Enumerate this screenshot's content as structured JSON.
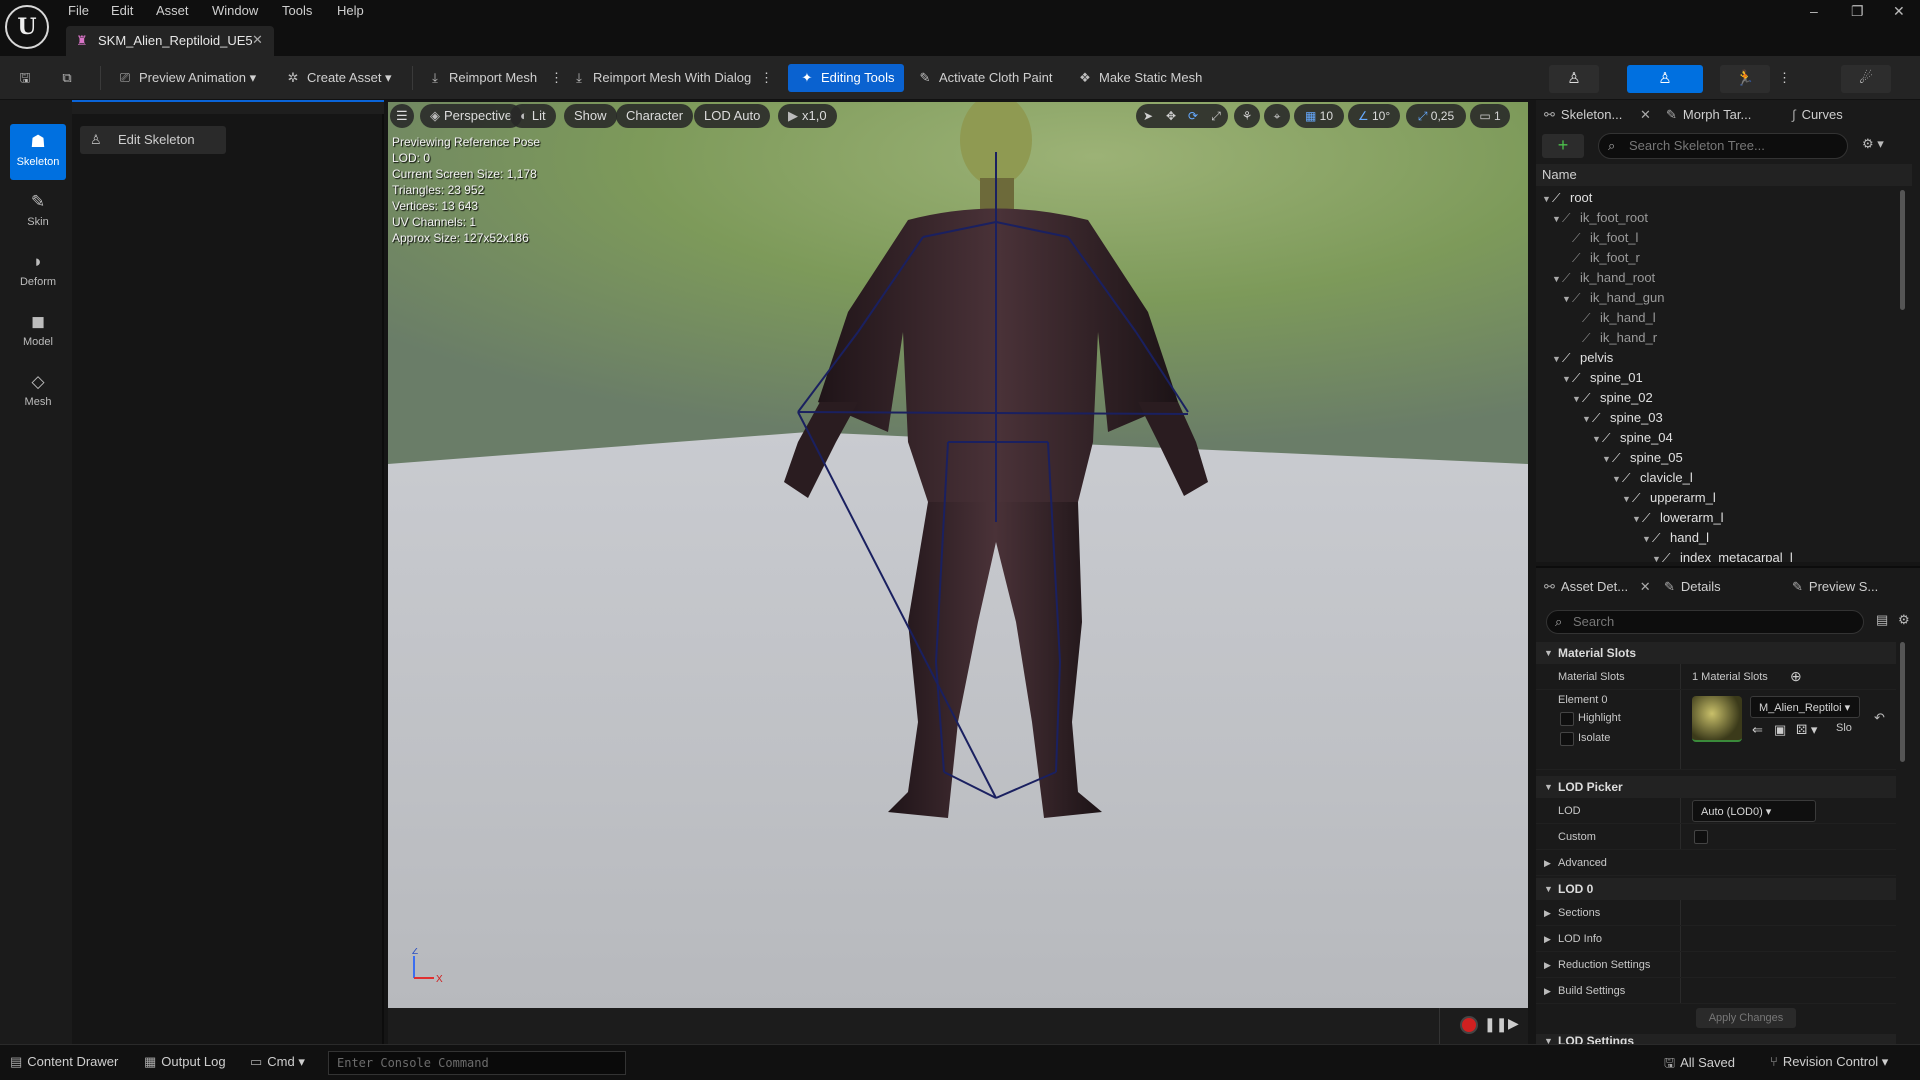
{
  "app": {
    "logo_text": "U",
    "menu": [
      "File",
      "Edit",
      "Asset",
      "Window",
      "Tools",
      "Help"
    ],
    "doc_tab": "SKM_Alien_Reptiloid_UE5",
    "window_controls": [
      "–",
      "❐",
      "✕"
    ]
  },
  "toolbar": {
    "preview_animation": "Preview Animation",
    "create_asset": "Create Asset",
    "reimport_mesh": "Reimport Mesh",
    "reimport_dialog": "Reimport Mesh With Dialog",
    "editing_tools": "Editing Tools",
    "cloth_paint": "Activate Cloth Paint",
    "make_static": "Make Static Mesh",
    "accent": "#0070e0"
  },
  "left_strip": [
    {
      "label": "Skeleton",
      "icon": "skeleton-icon",
      "glyph": "☗"
    },
    {
      "label": "Skin",
      "icon": "skin-icon",
      "glyph": "✎"
    },
    {
      "label": "Deform",
      "icon": "deform-icon",
      "glyph": "◗"
    },
    {
      "label": "Model",
      "icon": "model-icon",
      "glyph": "◼"
    },
    {
      "label": "Mesh",
      "icon": "mesh-icon",
      "glyph": "◇"
    }
  ],
  "left_panel": {
    "edit_skeleton": "Edit Skeleton"
  },
  "viewport": {
    "perspective": "Perspective",
    "lit": "Lit",
    "show": "Show",
    "character": "Character",
    "lod": "LOD Auto",
    "speed": "x1,0",
    "grid_snap": "10",
    "rot_snap": "10°",
    "scale_snap": "0,25",
    "camera_speed": "1",
    "stats": [
      "Previewing Reference Pose",
      "LOD: 0",
      "Current Screen Size: 1,178",
      "Triangles: 23 952",
      "Vertices: 13 643",
      "UV Channels: 1",
      "Approx Size: 127x52x186"
    ],
    "axis_z": "Z",
    "axis_x": "X"
  },
  "skeleton_panel": {
    "tabs": [
      "Skeleton...",
      "Morph Tar...",
      "Curves"
    ],
    "search_placeholder": "Search Skeleton Tree...",
    "column": "Name",
    "bones": [
      {
        "name": "root",
        "depth": 0,
        "expanded": true,
        "virtual": false
      },
      {
        "name": "ik_foot_root",
        "depth": 1,
        "expanded": true,
        "virtual": true
      },
      {
        "name": "ik_foot_l",
        "depth": 2,
        "expanded": false,
        "virtual": true
      },
      {
        "name": "ik_foot_r",
        "depth": 2,
        "expanded": false,
        "virtual": true
      },
      {
        "name": "ik_hand_root",
        "depth": 1,
        "expanded": true,
        "virtual": true
      },
      {
        "name": "ik_hand_gun",
        "depth": 2,
        "expanded": true,
        "virtual": true
      },
      {
        "name": "ik_hand_l",
        "depth": 3,
        "expanded": false,
        "virtual": true
      },
      {
        "name": "ik_hand_r",
        "depth": 3,
        "expanded": false,
        "virtual": true
      },
      {
        "name": "pelvis",
        "depth": 1,
        "expanded": true,
        "virtual": false
      },
      {
        "name": "spine_01",
        "depth": 2,
        "expanded": true,
        "virtual": false
      },
      {
        "name": "spine_02",
        "depth": 3,
        "expanded": true,
        "virtual": false
      },
      {
        "name": "spine_03",
        "depth": 4,
        "expanded": true,
        "virtual": false
      },
      {
        "name": "spine_04",
        "depth": 5,
        "expanded": true,
        "virtual": false
      },
      {
        "name": "spine_05",
        "depth": 6,
        "expanded": true,
        "virtual": false
      },
      {
        "name": "clavicle_l",
        "depth": 7,
        "expanded": true,
        "virtual": false
      },
      {
        "name": "upperarm_l",
        "depth": 8,
        "expanded": true,
        "virtual": false
      },
      {
        "name": "lowerarm_l",
        "depth": 9,
        "expanded": true,
        "virtual": false
      },
      {
        "name": "hand_l",
        "depth": 10,
        "expanded": true,
        "virtual": false
      },
      {
        "name": "index_metacarpal_l",
        "depth": 11,
        "expanded": true,
        "virtual": false
      }
    ]
  },
  "details_panel": {
    "tabs": [
      "Asset Det...",
      "Details",
      "Preview S..."
    ],
    "search_placeholder": "Search",
    "material_slots_section": "Material Slots",
    "material_slots_label": "Material Slots",
    "material_slots_value": "1 Material Slots",
    "element0": "Element 0",
    "highlight": "Highlight",
    "isolate": "Isolate",
    "material_name": "M_Alien_Reptiloi",
    "slot_label": "Slo",
    "lod_picker_section": "LOD Picker",
    "lod_label": "LOD",
    "lod_value": "Auto (LOD0)",
    "custom_label": "Custom",
    "advanced": "Advanced",
    "lod0_section": "LOD 0",
    "sections": "Sections",
    "lod_info": "LOD Info",
    "reduction": "Reduction Settings",
    "build": "Build Settings",
    "apply_changes": "Apply Changes",
    "lod_settings_section": "LOD Settings"
  },
  "statusbar": {
    "content_drawer": "Content Drawer",
    "output_log": "Output Log",
    "cmd": "Cmd",
    "console_placeholder": "Enter Console Command",
    "all_saved": "All Saved",
    "revision_control": "Revision Control"
  }
}
